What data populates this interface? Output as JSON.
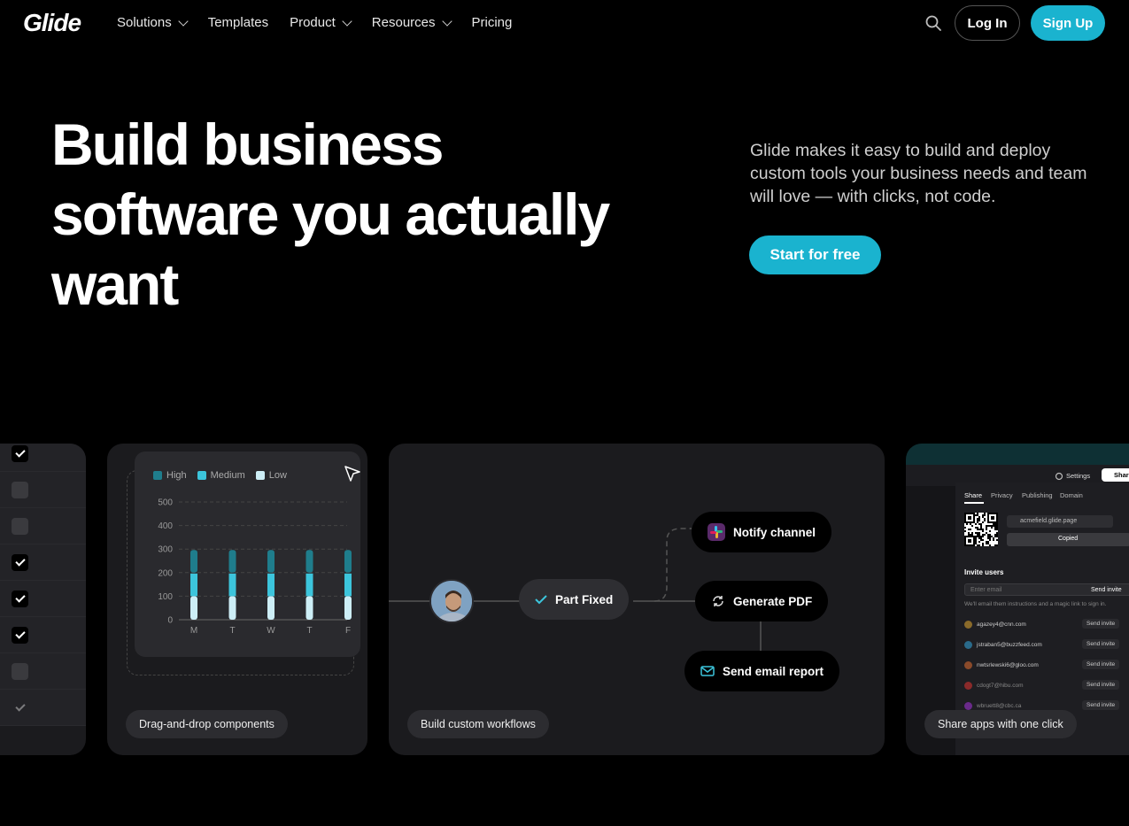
{
  "nav": {
    "logo": "Glide",
    "links": [
      "Solutions",
      "Templates",
      "Product",
      "Resources",
      "Pricing"
    ],
    "login": "Log In",
    "signup": "Sign Up"
  },
  "hero": {
    "title_lines": [
      "Build business",
      "software you actually",
      "want"
    ],
    "description": "Glide makes it easy to build and deploy custom tools your business needs and team will love — with clicks, not code.",
    "cta": "Start for free"
  },
  "cards": {
    "chart": {
      "label": "Drag-and-drop components",
      "legend": [
        "High",
        "Medium",
        "Low"
      ],
      "colors": {
        "high": "#1f7d8c",
        "medium": "#3cc5dc",
        "low": "#cdeef6"
      }
    },
    "flow": {
      "label": "Build custom workflows",
      "fixed": "Part Fixed",
      "notify": "Notify channel",
      "pdf": "Generate PDF",
      "email": "Send email report"
    },
    "share": {
      "label": "Share apps with one click",
      "settings": "Settings",
      "share_btn": "Shar",
      "tabs": [
        "Share",
        "Privacy",
        "Publishing",
        "Domain"
      ],
      "url": "acmefield.glide.page",
      "copied": "Copied",
      "invite_title": "Invite users",
      "email_placeholder": "Enter email",
      "send_invite": "Send invite",
      "hint": "We'll email them instructions and a magic link to sign in.",
      "users": [
        "agazey4@cnn.com",
        "jstraban5@buzzfeed.com",
        "nwtsrlewski6@gloo.com",
        "cdogt7@hibu.com",
        "wbruett8@cbc.ca"
      ]
    }
  },
  "chart_data": {
    "type": "bar",
    "categories": [
      "M",
      "T",
      "W",
      "T",
      "F"
    ],
    "series": [
      {
        "name": "Low",
        "values": [
          100,
          100,
          100,
          100,
          100
        ]
      },
      {
        "name": "Medium",
        "values": [
          100,
          100,
          100,
          100,
          100
        ]
      },
      {
        "name": "High",
        "values": [
          100,
          100,
          100,
          100,
          100
        ]
      }
    ],
    "yticks": [
      0,
      100,
      200,
      300,
      400,
      500
    ],
    "ylim": [
      0,
      500
    ],
    "stacked": true,
    "legend_position": "top-left",
    "grid": true
  },
  "checklist": [
    true,
    false,
    false,
    true,
    true,
    true,
    false,
    true
  ]
}
